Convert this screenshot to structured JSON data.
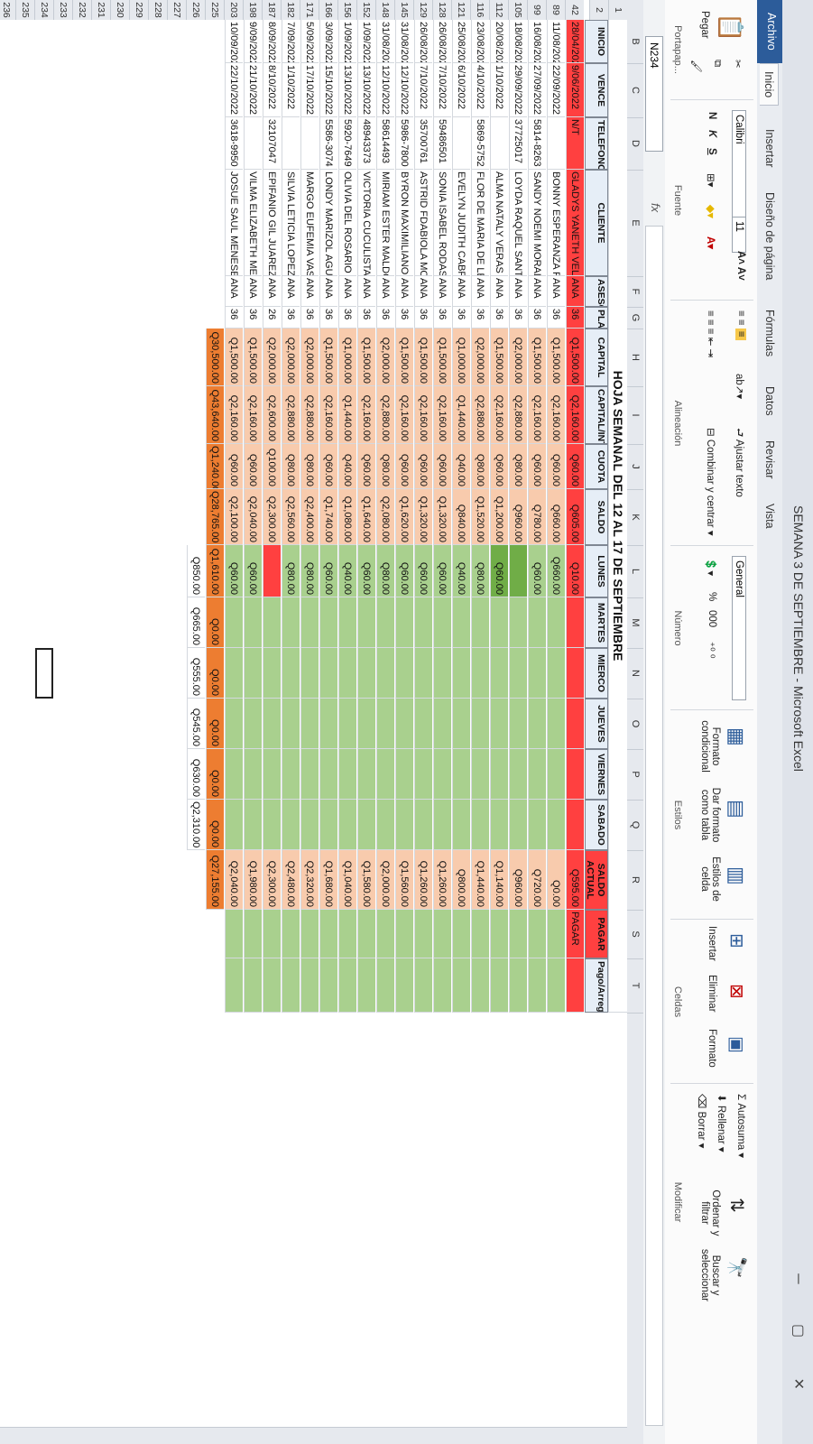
{
  "window": {
    "title": "SEMANA 3 DE SEPTIEMBRE - Microsoft Excel"
  },
  "tabs": [
    "Archivo",
    "Inicio",
    "Insertar",
    "Diseño de página",
    "Fórmulas",
    "Datos",
    "Revisar",
    "Vista"
  ],
  "ribbon": {
    "clipboard": {
      "paste": "Pegar",
      "label": "Portapap..."
    },
    "font": {
      "name": "Calibri",
      "size": "11",
      "label": "Fuente",
      "bold": "N",
      "italic": "K",
      "underline": "S"
    },
    "align": {
      "wrap": "Ajustar texto",
      "merge": "Combinar y centrar",
      "label": "Alineación"
    },
    "number": {
      "format": "General",
      "pct": "%",
      "thousands": "000",
      "label": "Número"
    },
    "styles": {
      "cond": "Formato condicional",
      "table": "Dar formato como tabla",
      "cell": "Estilos de celda",
      "label": "Estilos"
    },
    "cells": {
      "insert": "Insertar",
      "delete": "Eliminar",
      "format": "Formato",
      "label": "Celdas"
    },
    "edit": {
      "autosum": "Autosuma",
      "fill": "Rellenar",
      "clear": "Borrar",
      "sort": "Ordenar y filtrar",
      "find": "Buscar y seleccionar",
      "label": "Modificar"
    }
  },
  "namebox": "N234",
  "fx": "fx",
  "columns": [
    "B",
    "C",
    "D",
    "E",
    "F",
    "G",
    "H",
    "I",
    "J",
    "K",
    "L",
    "M",
    "N",
    "O",
    "P",
    "Q",
    "R",
    "S",
    "T"
  ],
  "title": "HOJA SEMANAL DEL 12 AL 17 DE SEPTIEMBRE",
  "headers": [
    "INICIO",
    "VENCE",
    "TELEFONO",
    "CLIENTE",
    "ASESOR",
    "PLAZO",
    "CAPITAL",
    "CAPITAL/INTERES",
    "CUOTA",
    "SALDO",
    "LUNES",
    "MARTES",
    "MIERCO",
    "JUEVES",
    "VIERNES",
    "SABADO",
    "SALDO ACTUAL",
    "PAGAR",
    "Pago/Arreg"
  ],
  "rows": [
    {
      "n": "42",
      "inicio": "28/04/2022",
      "vence": "9/06/2022",
      "tel": "N/T",
      "cliente": "GLADYS YANETH VELASQ",
      "asesor": "ANA",
      "plazo": "36",
      "capital": "Q1,500.00",
      "capint": "Q2,160.00",
      "cuota": "Q60.00",
      "saldo": "Q605.00",
      "lunes": "Q10.00",
      "sactual": "Q595.00",
      "pagar": "PAGAR"
    },
    {
      "n": "89",
      "inicio": "11/08/2022",
      "vence": "22/09/2022",
      "tel": "",
      "cliente": "BONNY ESPERANZA RIOS",
      "asesor": "ANA",
      "plazo": "36",
      "capital": "Q1,500.00",
      "capint": "Q2,160.00",
      "cuota": "Q60.00",
      "saldo": "Q660.00",
      "lunes": "Q660.00",
      "sactual": "Q0.00",
      "pagar": ""
    },
    {
      "n": "99",
      "inicio": "16/08/2022",
      "vence": "27/09/2022",
      "tel": "5814-8263",
      "cliente": "SANDY NOEMI MORALES",
      "asesor": "ANA",
      "plazo": "36",
      "capital": "Q1,500.00",
      "capint": "Q2,160.00",
      "cuota": "Q60.00",
      "saldo": "Q780.00",
      "lunes": "Q60.00",
      "sactual": "Q720.00",
      "pagar": ""
    },
    {
      "n": "105",
      "inicio": "18/08/2022",
      "vence": "29/09/2022",
      "tel": "37725017",
      "cliente": "LOYDA RAQUEL SANTAY",
      "asesor": "ANA",
      "plazo": "36",
      "capital": "Q2,000.00",
      "capint": "Q2,880.00",
      "cuota": "Q80.00",
      "saldo": "Q960.00",
      "lunes": "",
      "sactual": "Q960.00",
      "pagar": ""
    },
    {
      "n": "112",
      "inicio": "20/08/2022",
      "vence": "1/10/2022",
      "tel": "",
      "cliente": "ALMA NATALY VERAS RIO",
      "asesor": "ANA",
      "plazo": "36",
      "capital": "Q1,500.00",
      "capint": "Q2,160.00",
      "cuota": "Q60.00",
      "saldo": "Q1,200.00",
      "lunes": "Q60.00",
      "sactual": "Q1,140.00",
      "pagar": ""
    },
    {
      "n": "116",
      "inicio": "23/08/2022",
      "vence": "4/10/2022",
      "tel": "5869-5752",
      "cliente": "FLOR DE MARIA DE LEON",
      "asesor": "ANA",
      "plazo": "36",
      "capital": "Q2,000.00",
      "capint": "Q2,880.00",
      "cuota": "Q80.00",
      "saldo": "Q1,520.00",
      "lunes": "Q80.00",
      "sactual": "Q1,440.00",
      "pagar": ""
    },
    {
      "n": "121",
      "inicio": "25/08/2022",
      "vence": "6/10/2022",
      "tel": "",
      "cliente": "EVELYN JUDITH CABRER",
      "asesor": "ANA",
      "plazo": "36",
      "capital": "Q1,000.00",
      "capint": "Q1,440.00",
      "cuota": "Q40.00",
      "saldo": "Q840.00",
      "lunes": "Q40.00",
      "sactual": "Q800.00",
      "pagar": ""
    },
    {
      "n": "128",
      "inicio": "26/08/2022",
      "vence": "7/10/2022",
      "tel": "59486501",
      "cliente": "SONIA ISABEL RODAS",
      "asesor": "ANA",
      "plazo": "36",
      "capital": "Q1,500.00",
      "capint": "Q2,160.00",
      "cuota": "Q60.00",
      "saldo": "Q1,320.00",
      "lunes": "Q60.00",
      "sactual": "Q1,260.00",
      "pagar": ""
    },
    {
      "n": "129",
      "inicio": "26/08/2022",
      "vence": "7/10/2022",
      "tel": "35700761",
      "cliente": "ASTRID FDABIOLA MORA",
      "asesor": "ANA",
      "plazo": "36",
      "capital": "Q1,500.00",
      "capint": "Q2,160.00",
      "cuota": "Q60.00",
      "saldo": "Q1,320.00",
      "lunes": "Q60.00",
      "sactual": "Q1,260.00",
      "pagar": ""
    },
    {
      "n": "145",
      "inicio": "31/08/2022",
      "vence": "12/10/2022",
      "tel": "5986-7800",
      "cliente": "BYRON MAXIMILIANO OL",
      "asesor": "ANA",
      "plazo": "36",
      "capital": "Q1,500.00",
      "capint": "Q2,160.00",
      "cuota": "Q60.00",
      "saldo": "Q1,620.00",
      "lunes": "Q60.00",
      "sactual": "Q1,560.00",
      "pagar": ""
    },
    {
      "n": "148",
      "inicio": "31/08/2022",
      "vence": "12/10/2022",
      "tel": "58614493",
      "cliente": "MIRIAM ESTER MALDON",
      "asesor": "ANA",
      "plazo": "36",
      "capital": "Q2,000.00",
      "capint": "Q2,880.00",
      "cuota": "Q80.00",
      "saldo": "Q2,080.00",
      "lunes": "Q80.00",
      "sactual": "Q2,000.00",
      "pagar": ""
    },
    {
      "n": "152",
      "inicio": "1/09/2022",
      "vence": "13/10/2022",
      "tel": "48943373",
      "cliente": "VICTORIA CUCULISTA DE",
      "asesor": "ANA",
      "plazo": "36",
      "capital": "Q1,500.00",
      "capint": "Q2,160.00",
      "cuota": "Q60.00",
      "saldo": "Q1,640.00",
      "lunes": "Q60.00",
      "sactual": "Q1,580.00",
      "pagar": ""
    },
    {
      "n": "156",
      "inicio": "1/09/2022",
      "vence": "13/10/2022",
      "tel": "5920-7649",
      "cliente": "OLIVIA DEL ROSARIO AG",
      "asesor": "ANA",
      "plazo": "36",
      "capital": "Q1,000.00",
      "capint": "Q1,440.00",
      "cuota": "Q40.00",
      "saldo": "Q1,080.00",
      "lunes": "Q40.00",
      "sactual": "Q1,040.00",
      "pagar": ""
    },
    {
      "n": "166",
      "inicio": "3/09/2022",
      "vence": "15/10/2022",
      "tel": "5586-3074",
      "cliente": "LONDY MARIZOL AGUILA",
      "asesor": "ANA",
      "plazo": "36",
      "capital": "Q1,500.00",
      "capint": "Q2,160.00",
      "cuota": "Q60.00",
      "saldo": "Q1,740.00",
      "lunes": "Q60.00",
      "sactual": "Q1,680.00",
      "pagar": ""
    },
    {
      "n": "171",
      "inicio": "5/09/2022",
      "vence": "17/10/2022",
      "tel": "",
      "cliente": "MARGO EUFEMIA VASQU",
      "asesor": "ANA",
      "plazo": "36",
      "capital": "Q2,000.00",
      "capint": "Q2,880.00",
      "cuota": "Q80.00",
      "saldo": "Q2,400.00",
      "lunes": "Q80.00",
      "sactual": "Q2,320.00",
      "pagar": ""
    },
    {
      "n": "182",
      "inicio": "7/09/2022",
      "vence": "1/10/2022",
      "tel": "",
      "cliente": "SILVIA LETICIA LOPEZ",
      "asesor": "ANA",
      "plazo": "36",
      "capital": "Q2,000.00",
      "capint": "Q2,880.00",
      "cuota": "Q80.00",
      "saldo": "Q2,560.00",
      "lunes": "Q80.00",
      "sactual": "Q2,480.00",
      "pagar": ""
    },
    {
      "n": "187",
      "inicio": "8/09/2022",
      "vence": "8/10/2022",
      "tel": "32107047",
      "cliente": "EPIFANIO GIL JUAREZ",
      "asesor": "ANA",
      "plazo": "26",
      "capital": "Q2,000.00",
      "capint": "Q2,600.00",
      "cuota": "Q100.00",
      "saldo": "Q2,300.00",
      "lunes": "",
      "sactual": "Q2,300.00",
      "pagar": ""
    },
    {
      "n": "198",
      "inicio": "9/09/2022",
      "vence": "21/10/2022",
      "tel": "",
      "cliente": "VILMA ELIZABETH MEND",
      "asesor": "ANA",
      "plazo": "36",
      "capital": "Q1,500.00",
      "capint": "Q2,160.00",
      "cuota": "Q60.00",
      "saldo": "Q2,040.00",
      "lunes": "Q60.00",
      "sactual": "Q1,980.00",
      "pagar": ""
    },
    {
      "n": "203",
      "inicio": "10/09/2022",
      "vence": "22/10/2022",
      "tel": "3618-9950",
      "cliente": "JOSUE SAUL MENESES ES",
      "asesor": "ANA",
      "plazo": "36",
      "capital": "Q1,500.00",
      "capint": "Q2,160.00",
      "cuota": "Q60.00",
      "saldo": "Q2,100.00",
      "lunes": "Q60.00",
      "sactual": "Q2,040.00",
      "pagar": ""
    }
  ],
  "totals": {
    "capital": "Q30,500.00",
    "capint": "Q43,640.00",
    "cuota": "Q1,240.00",
    "saldo": "Q28,765.00",
    "lunes": "Q1,610.00",
    "martes": "Q0.00",
    "mierco": "Q0.00",
    "jueves": "Q0.00",
    "viernes": "Q0.00",
    "sabado": "Q0.00",
    "sactual": "Q27,155.00"
  },
  "weekly": {
    "lunes": "Q850.00",
    "martes": "Q665.00",
    "mierco": "Q555.00",
    "jueves": "Q545.00",
    "viernes": "Q630.00",
    "sabado": "Q2,310.00"
  },
  "empty_rows": [
    "225",
    "226",
    "227",
    "228",
    "229",
    "230",
    "231",
    "232",
    "233",
    "234",
    "235",
    "236"
  ],
  "colors": {
    "header_red": "#ff4040",
    "orange": "#ed7d31",
    "green": "#a9d08e",
    "excel_blue": "#2c5c9a"
  }
}
